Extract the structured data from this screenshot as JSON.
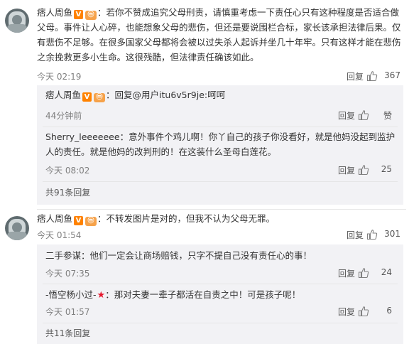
{
  "comments": [
    {
      "user": "痞人周鱼",
      "v_badge": "V",
      "m_badge": "ⓜ",
      "text": "若你不赞成追究父母刑责，请慎重考虑一下责任心只有这种程度是否适合做父母。事件让人心碎，也能想象父母的悲伤，但还是要说围栏合标，家长该承担法律后果。仅有悲伤不足够。在很多国家父母都将会被以过失杀人起诉并坐几十年牢。只有这样才能在悲伤之余挽救更多小生命。这很残酷，但法律责任确该如此。",
      "time": "今天 02:19",
      "reply_label": "回复",
      "likes": "367",
      "replies": [
        {
          "user": "痞人周鱼",
          "v_badge": "V",
          "m_badge": "ⓜ",
          "text": "回复@用户itu6v5r9je:呵呵",
          "time": "44分钟前",
          "reply_label": "回复",
          "likes": "赞"
        },
        {
          "user": "Sherry_leeeeeee",
          "text": "意外事件个鸡儿啊！你丫自己的孩子你没看好，就是他妈没起到监护人的责任。就是他妈的改判刑的！在这装什么圣母白莲花。",
          "time": "今天 08:02",
          "reply_label": "回复",
          "likes": "25"
        }
      ],
      "more_label": "共91条回复"
    },
    {
      "user": "痞人周鱼",
      "v_badge": "V",
      "m_badge": "ⓜ",
      "text": "不转发图片是对的，但我不认为父母无罪。",
      "time": "今天 01:54",
      "reply_label": "回复",
      "likes": "301",
      "replies": [
        {
          "user": "二手参谋",
          "text": "他们一定会让商场赔钱，只字不提自己没有责任心的事！",
          "time": "今天 07:35",
          "reply_label": "回复",
          "likes": "24"
        },
        {
          "user": "-悟空杨小过-",
          "badge": "★",
          "text": "那对夫妻一辈子都活在自责之中！可是孩子呢！",
          "time": "今天 01:57",
          "reply_label": "回复",
          "likes": "6"
        }
      ],
      "more_label": "共11条回复"
    }
  ],
  "colors": {
    "v_badge": "#ff8200",
    "m_badge": "#f6a24a",
    "star": "#e6162d",
    "sub_bg": "#f2f2f5"
  },
  "icons": {
    "like": "thumbs-up-icon",
    "avatar": "user-avatar"
  }
}
